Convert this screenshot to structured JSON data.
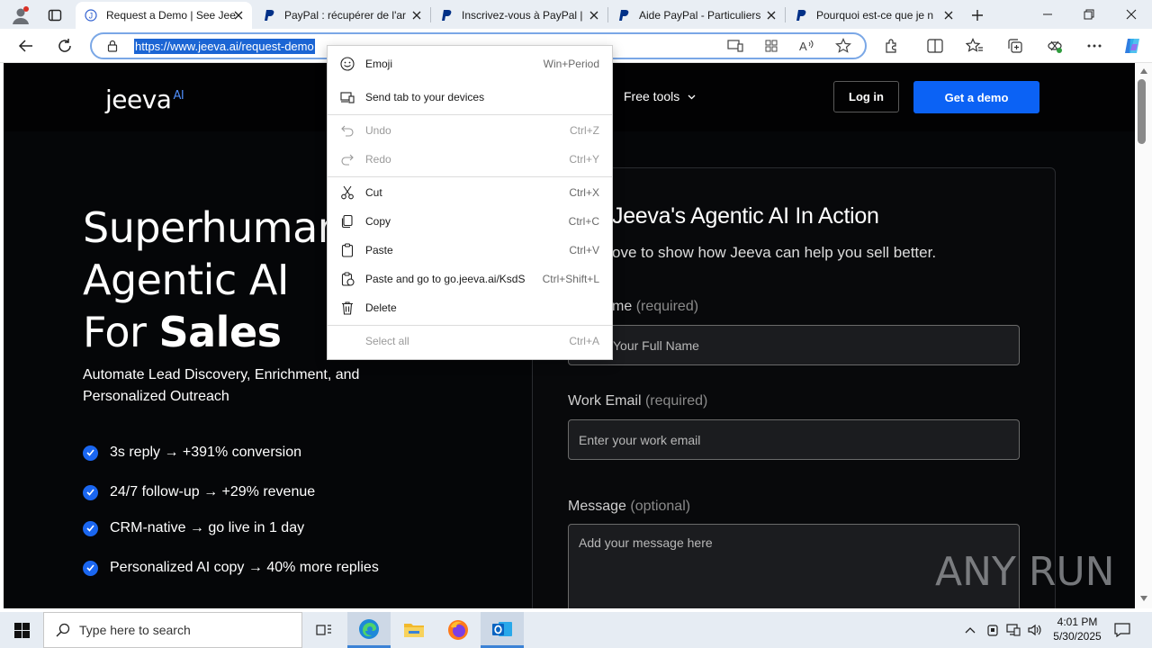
{
  "browser": {
    "tabs": [
      {
        "label": "Request a Demo | See Jee",
        "icon": "jeeva-favicon",
        "active": true
      },
      {
        "label": "PayPal : récupérer de l'ar",
        "icon": "paypal-icon",
        "active": false
      },
      {
        "label": "Inscrivez-vous à PayPal |",
        "icon": "paypal-icon",
        "active": false
      },
      {
        "label": "Aide PayPal - Particuliers",
        "icon": "paypal-icon",
        "active": false
      },
      {
        "label": "Pourquoi est-ce que je n",
        "icon": "paypal-icon",
        "active": false
      }
    ],
    "url": "https://www.jeeva.ai/request-demo"
  },
  "context_menu": {
    "items": [
      {
        "label": "Emoji",
        "shortcut": "Win+Period",
        "icon": "emoji-icon",
        "disabled": false
      },
      {
        "label": "Send tab to your devices",
        "shortcut": "",
        "icon": "send-tab-icon",
        "disabled": false
      },
      {
        "label": "Undo",
        "shortcut": "Ctrl+Z",
        "icon": "undo-icon",
        "disabled": true
      },
      {
        "label": "Redo",
        "shortcut": "Ctrl+Y",
        "icon": "redo-icon",
        "disabled": true
      },
      {
        "label": "Cut",
        "shortcut": "Ctrl+X",
        "icon": "scissors-icon",
        "disabled": false
      },
      {
        "label": "Copy",
        "shortcut": "Ctrl+C",
        "icon": "copy-icon",
        "disabled": false
      },
      {
        "label": "Paste",
        "shortcut": "Ctrl+V",
        "icon": "paste-icon",
        "disabled": false
      },
      {
        "label": "Paste and go to go.jeeva.ai/KsdS",
        "shortcut": "Ctrl+Shift+L",
        "icon": "paste-go-icon",
        "disabled": false
      },
      {
        "label": "Delete",
        "shortcut": "",
        "icon": "trash-icon",
        "disabled": false
      },
      {
        "label": "Select all",
        "shortcut": "Ctrl+A",
        "icon": "",
        "disabled": true
      }
    ]
  },
  "site": {
    "logo": "jeeva",
    "logo_suffix": "AI",
    "nav_free_tools": "Free tools",
    "login": "Log in",
    "get_demo": "Get a demo",
    "hero_line1": "Superhuman",
    "hero_line2": "Agentic AI",
    "hero_line3_prefix": "For ",
    "hero_line3_bold": "Sales",
    "subhero": "Automate Lead Discovery, Enrichment, and Personalized Outreach",
    "bullets": [
      "3s reply → +391% conversion",
      "24/7 follow-up → +29% revenue",
      "CRM-native → go live in 1 day",
      "Personalized AI copy → 40% more replies"
    ],
    "form": {
      "title": "Jeeva's Agentic AI In Action",
      "subtitle": "ove to show how Jeeva can help you sell better.",
      "name_label": "me",
      "name_req": "(required)",
      "name_placeholder": "Your Full Name",
      "email_label": "Work Email",
      "email_req": "(required)",
      "email_placeholder": "Enter your work email",
      "message_label": "Message",
      "message_opt": "(optional)",
      "message_placeholder": "Add your message here"
    },
    "watermark": "ANY RUN"
  },
  "taskbar": {
    "search_placeholder": "Type here to search",
    "time": "4:01 PM",
    "date": "5/30/2025"
  },
  "colors": {
    "accent": "#0b62f5",
    "url_highlight": "#1b65d4",
    "page_bg": "#050608"
  }
}
